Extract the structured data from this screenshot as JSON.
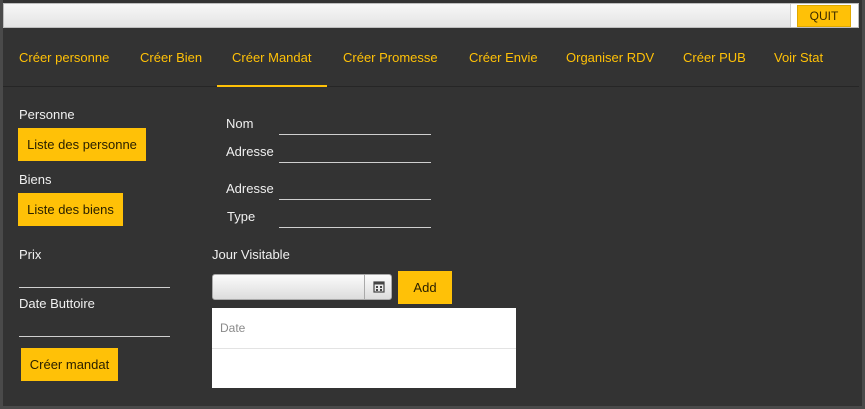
{
  "header": {
    "quit_label": "QUIT"
  },
  "tabs": [
    {
      "label": "Créer personne"
    },
    {
      "label": "Créer Bien"
    },
    {
      "label": "Créer Mandat",
      "active": true
    },
    {
      "label": "Créer Promesse"
    },
    {
      "label": "Créer Envie"
    },
    {
      "label": "Organiser RDV"
    },
    {
      "label": "Créer PUB"
    },
    {
      "label": "Voir Stat"
    }
  ],
  "left": {
    "personne_label": "Personne",
    "personne_button": "Liste des personne",
    "biens_label": "Biens",
    "biens_button": "Liste des biens",
    "prix_label": "Prix",
    "prix_value": "",
    "date_label": "Date Buttoire",
    "date_value": "",
    "create_button": "Créer mandat"
  },
  "form": {
    "nom_label": "Nom",
    "nom_value": "",
    "adresse1_label": "Adresse",
    "adresse1_value": "",
    "adresse2_label": "Adresse",
    "adresse2_value": "",
    "type_label": "Type",
    "type_value": ""
  },
  "visit": {
    "label": "Jour Visitable",
    "date_value": "",
    "add_button": "Add",
    "calendar_icon": "calendar-icon",
    "table": {
      "columns": [
        "Date"
      ],
      "rows": []
    }
  },
  "colors": {
    "accent": "#ffc107",
    "background": "#333333",
    "text": "#f0f0f0"
  }
}
